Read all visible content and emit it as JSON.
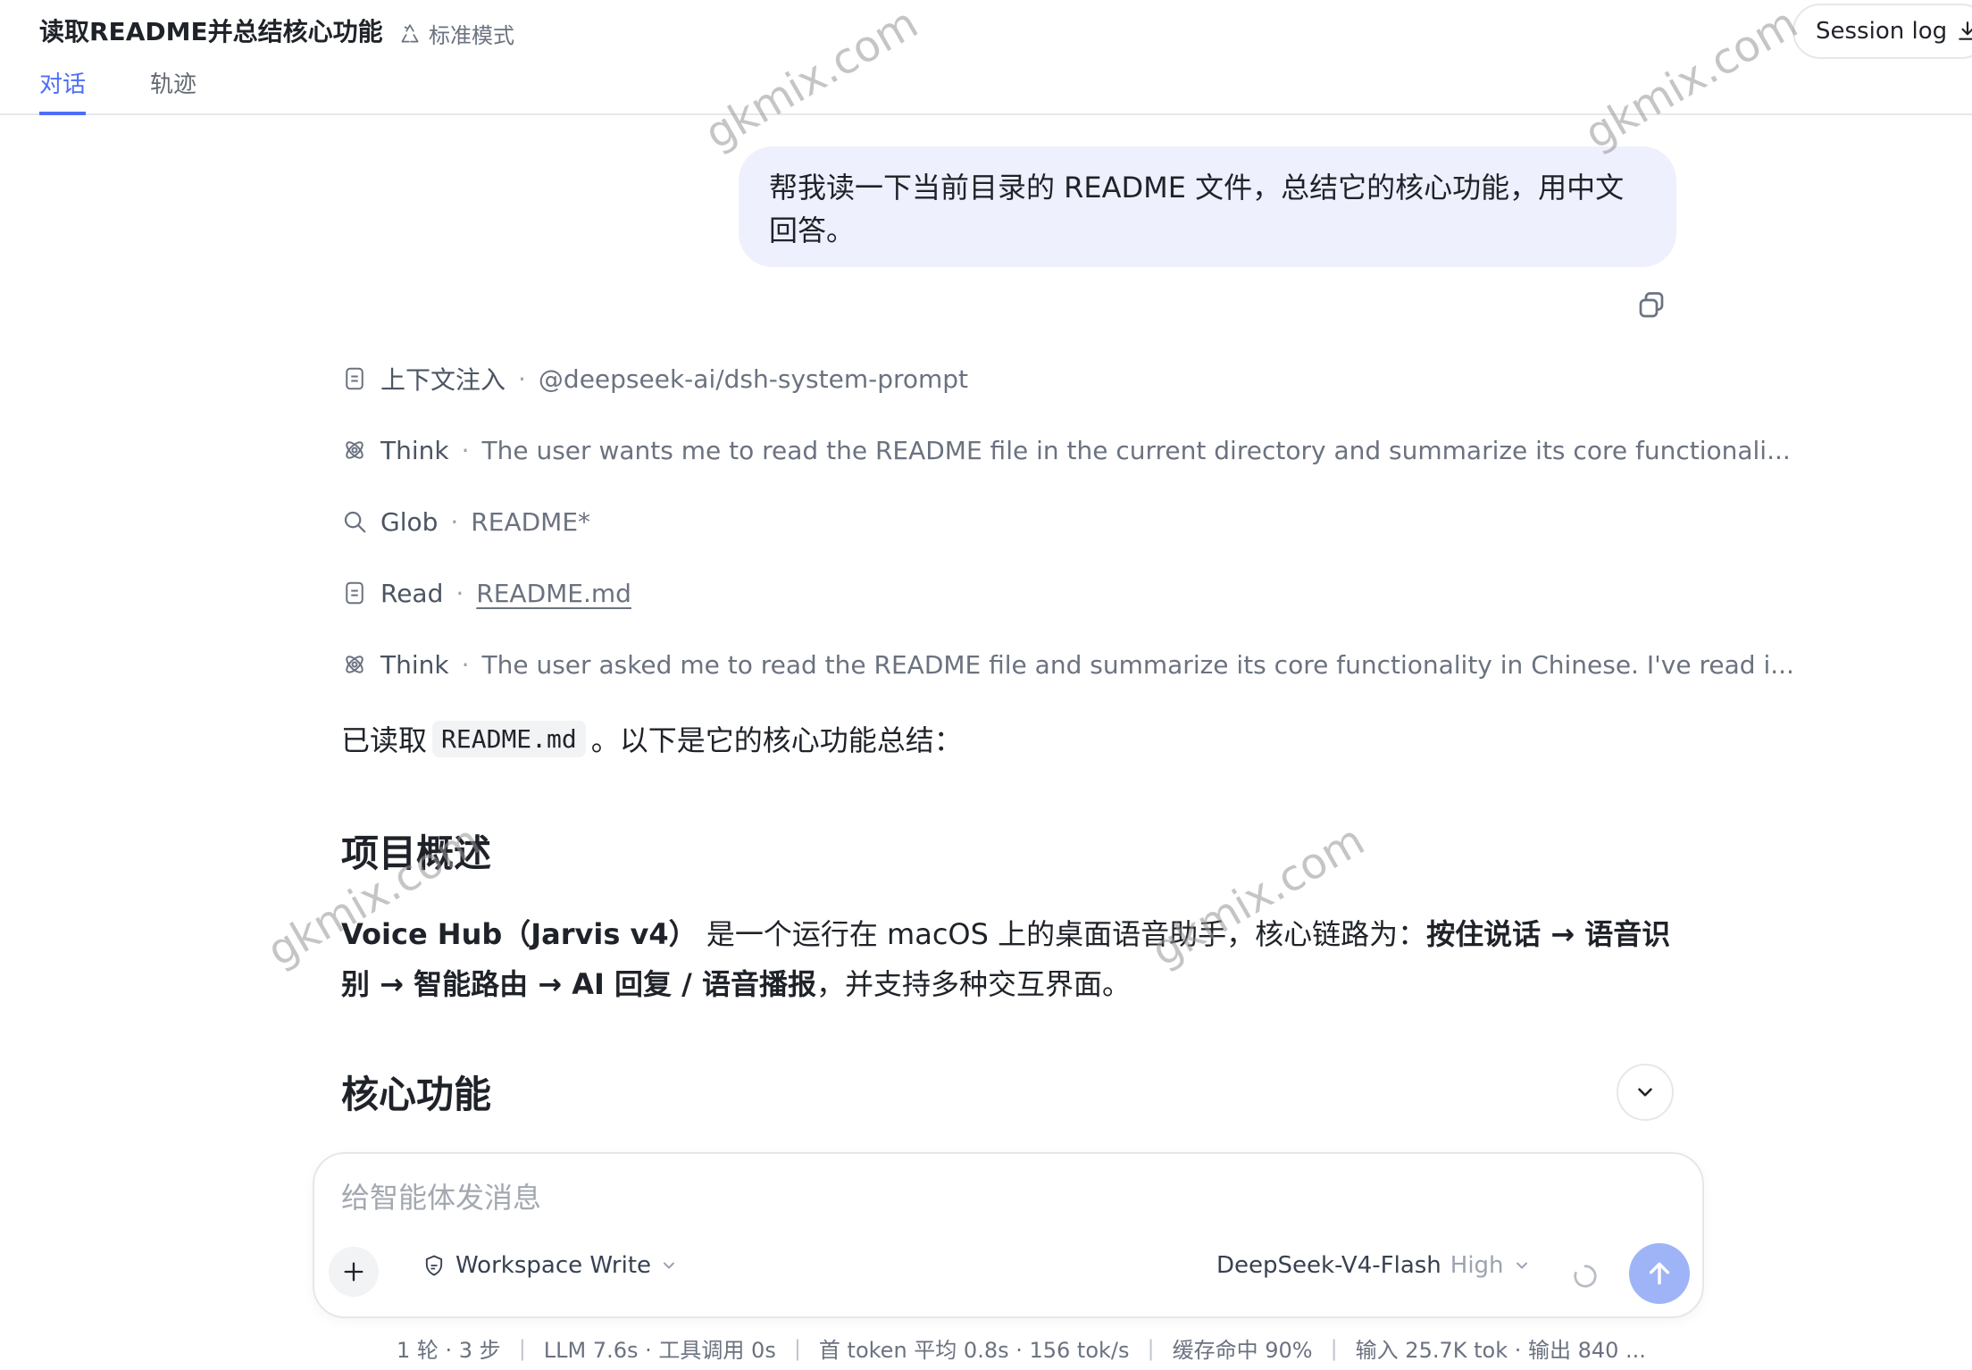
{
  "header": {
    "title": "读取README并总结核心功能",
    "mode_label": "标准模式",
    "tabs": [
      {
        "label": "对话",
        "active": true
      },
      {
        "label": "轨迹",
        "active": false
      }
    ],
    "session_log_label": "Session log"
  },
  "user_message": {
    "text": "帮我读一下当前目录的 README 文件，总结它的核心功能，用中文回答。"
  },
  "trace": [
    {
      "icon": "document-icon",
      "name": "上下文注入",
      "detail": "@deepseek-ai/dsh-system-prompt",
      "link": false
    },
    {
      "icon": "think-icon",
      "name": "Think",
      "detail": "The user wants me to read the README file in the current directory and summarize its core functionali...",
      "link": false
    },
    {
      "icon": "search-icon",
      "name": "Glob",
      "detail": "README*",
      "link": false
    },
    {
      "icon": "document-icon",
      "name": "Read",
      "detail": "README.md",
      "link": true
    },
    {
      "icon": "think-icon",
      "name": "Think",
      "detail": "The user asked me to read the README file and summarize its core functionality in Chinese. I've read i...",
      "link": false
    }
  ],
  "answer": {
    "intro_prefix": "已读取",
    "intro_code": "README.md",
    "intro_suffix": "。以下是它的核心功能总结：",
    "section1_title": "项目概述",
    "para_bold1": "Voice Hub（Jarvis v4）",
    "para_text1": " 是一个运行在 macOS 上的桌面语音助手，核心链路为：",
    "para_bold2": "按住说话 → 语音识别 → 智能路由 → AI 回复 / 语音播报",
    "para_text2": "，并支持多种交互界面。",
    "section2_title": "核心功能"
  },
  "composer": {
    "placeholder": "给智能体发消息",
    "value": "",
    "workspace_mode": "Workspace Write",
    "model_name": "DeepSeek-V4-Flash",
    "model_level": "High"
  },
  "stats": [
    "1 轮 · 3 步",
    "LLM 7.6s · 工具调用 0s",
    "首 token 平均 0.8s · 156 tok/s",
    "缓存命中 90%",
    "输入 25.7K tok · 输出 840 ..."
  ],
  "watermark": "gkmix.com",
  "colors": {
    "accent": "#4f6ef7",
    "bubble_bg": "#eef0fd",
    "send_button": "#9fb4f7"
  }
}
